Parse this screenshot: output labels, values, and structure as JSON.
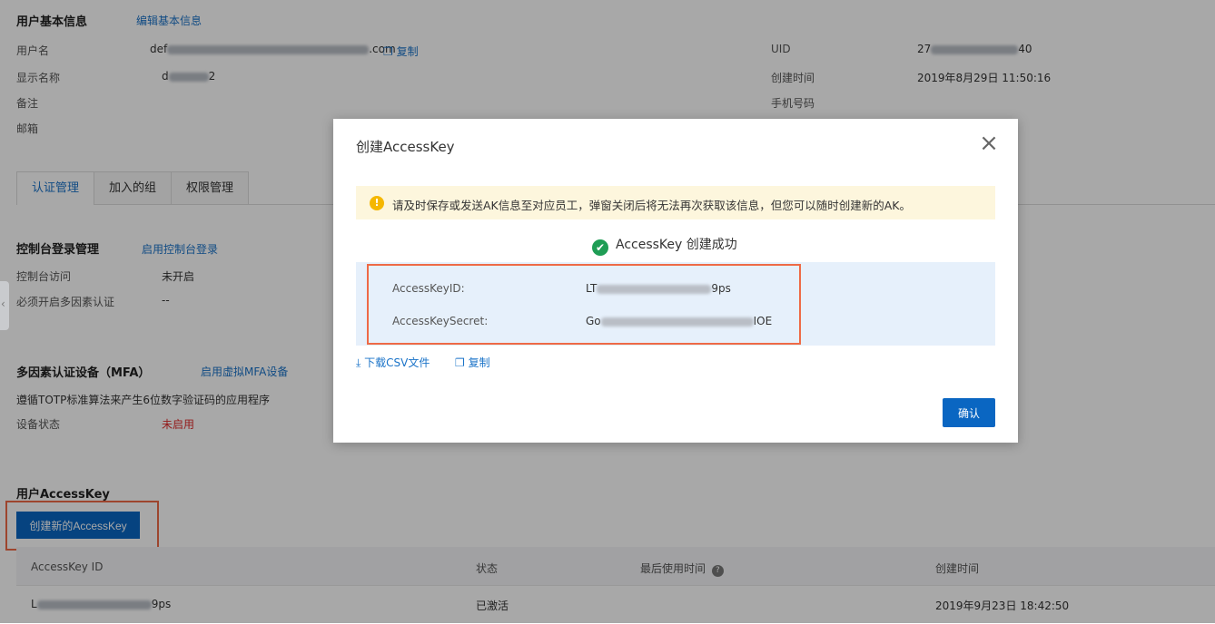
{
  "basic_info": {
    "title": "用户基本信息",
    "edit_link": "编辑基本信息",
    "fields": {
      "username_label": "用户名",
      "username_prefix": "def",
      "username_suffix": ".com",
      "copy_label": "复制",
      "display_name_label": "显示名称",
      "display_name_prefix": "d",
      "display_name_suffix": "2",
      "remark_label": "备注",
      "email_label": "邮箱",
      "uid_label": "UID",
      "uid_prefix": "27",
      "uid_suffix": "40",
      "created_label": "创建时间",
      "created_value": "2019年8月29日 11:50:16",
      "phone_label": "手机号码"
    }
  },
  "tabs": [
    {
      "label": "认证管理",
      "active": true
    },
    {
      "label": "加入的组",
      "active": false
    },
    {
      "label": "权限管理",
      "active": false
    }
  ],
  "console_login": {
    "title": "控制台登录管理",
    "enable_link": "启用控制台登录",
    "access_label": "控制台访问",
    "access_value": "未开启",
    "mfa_required_label": "必须开启多因素认证",
    "mfa_required_value": "--"
  },
  "mfa": {
    "title": "多因素认证设备（MFA）",
    "enable_link": "启用虚拟MFA设备",
    "description": "遵循TOTP标准算法来产生6位数字验证码的应用程序",
    "status_label": "设备状态",
    "status_value": "未启用",
    "status_color": "#e02b2b"
  },
  "access_key": {
    "title": "用户AccessKey",
    "create_button": "创建新的AccessKey",
    "columns": [
      "AccessKey ID",
      "状态",
      "最后使用时间",
      "创建时间"
    ],
    "rows": [
      {
        "id_prefix": "L",
        "id_suffix": "9ps",
        "status": "已激活",
        "created": "2019年9月23日 18:42:50"
      }
    ]
  },
  "modal": {
    "title": "创建AccessKey",
    "warning": "请及时保存或发送AK信息至对应员工，弹窗关闭后将无法再次获取该信息，但您可以随时创建新的AK。",
    "success": "AccessKey 创建成功",
    "id_label": "AccessKeyID:",
    "id_prefix": "LT",
    "id_suffix": "9ps",
    "secret_label": "AccessKeySecret:",
    "secret_prefix": "Go",
    "secret_suffix": "IOE",
    "download_label": "下载CSV文件",
    "copy_label": "复制",
    "confirm_label": "确认"
  },
  "colors": {
    "accent": "#0a66c2",
    "link": "#1a73c8",
    "highlight_border": "#ee6a46",
    "success": "#1f9d55",
    "warning": "#f5b700"
  }
}
